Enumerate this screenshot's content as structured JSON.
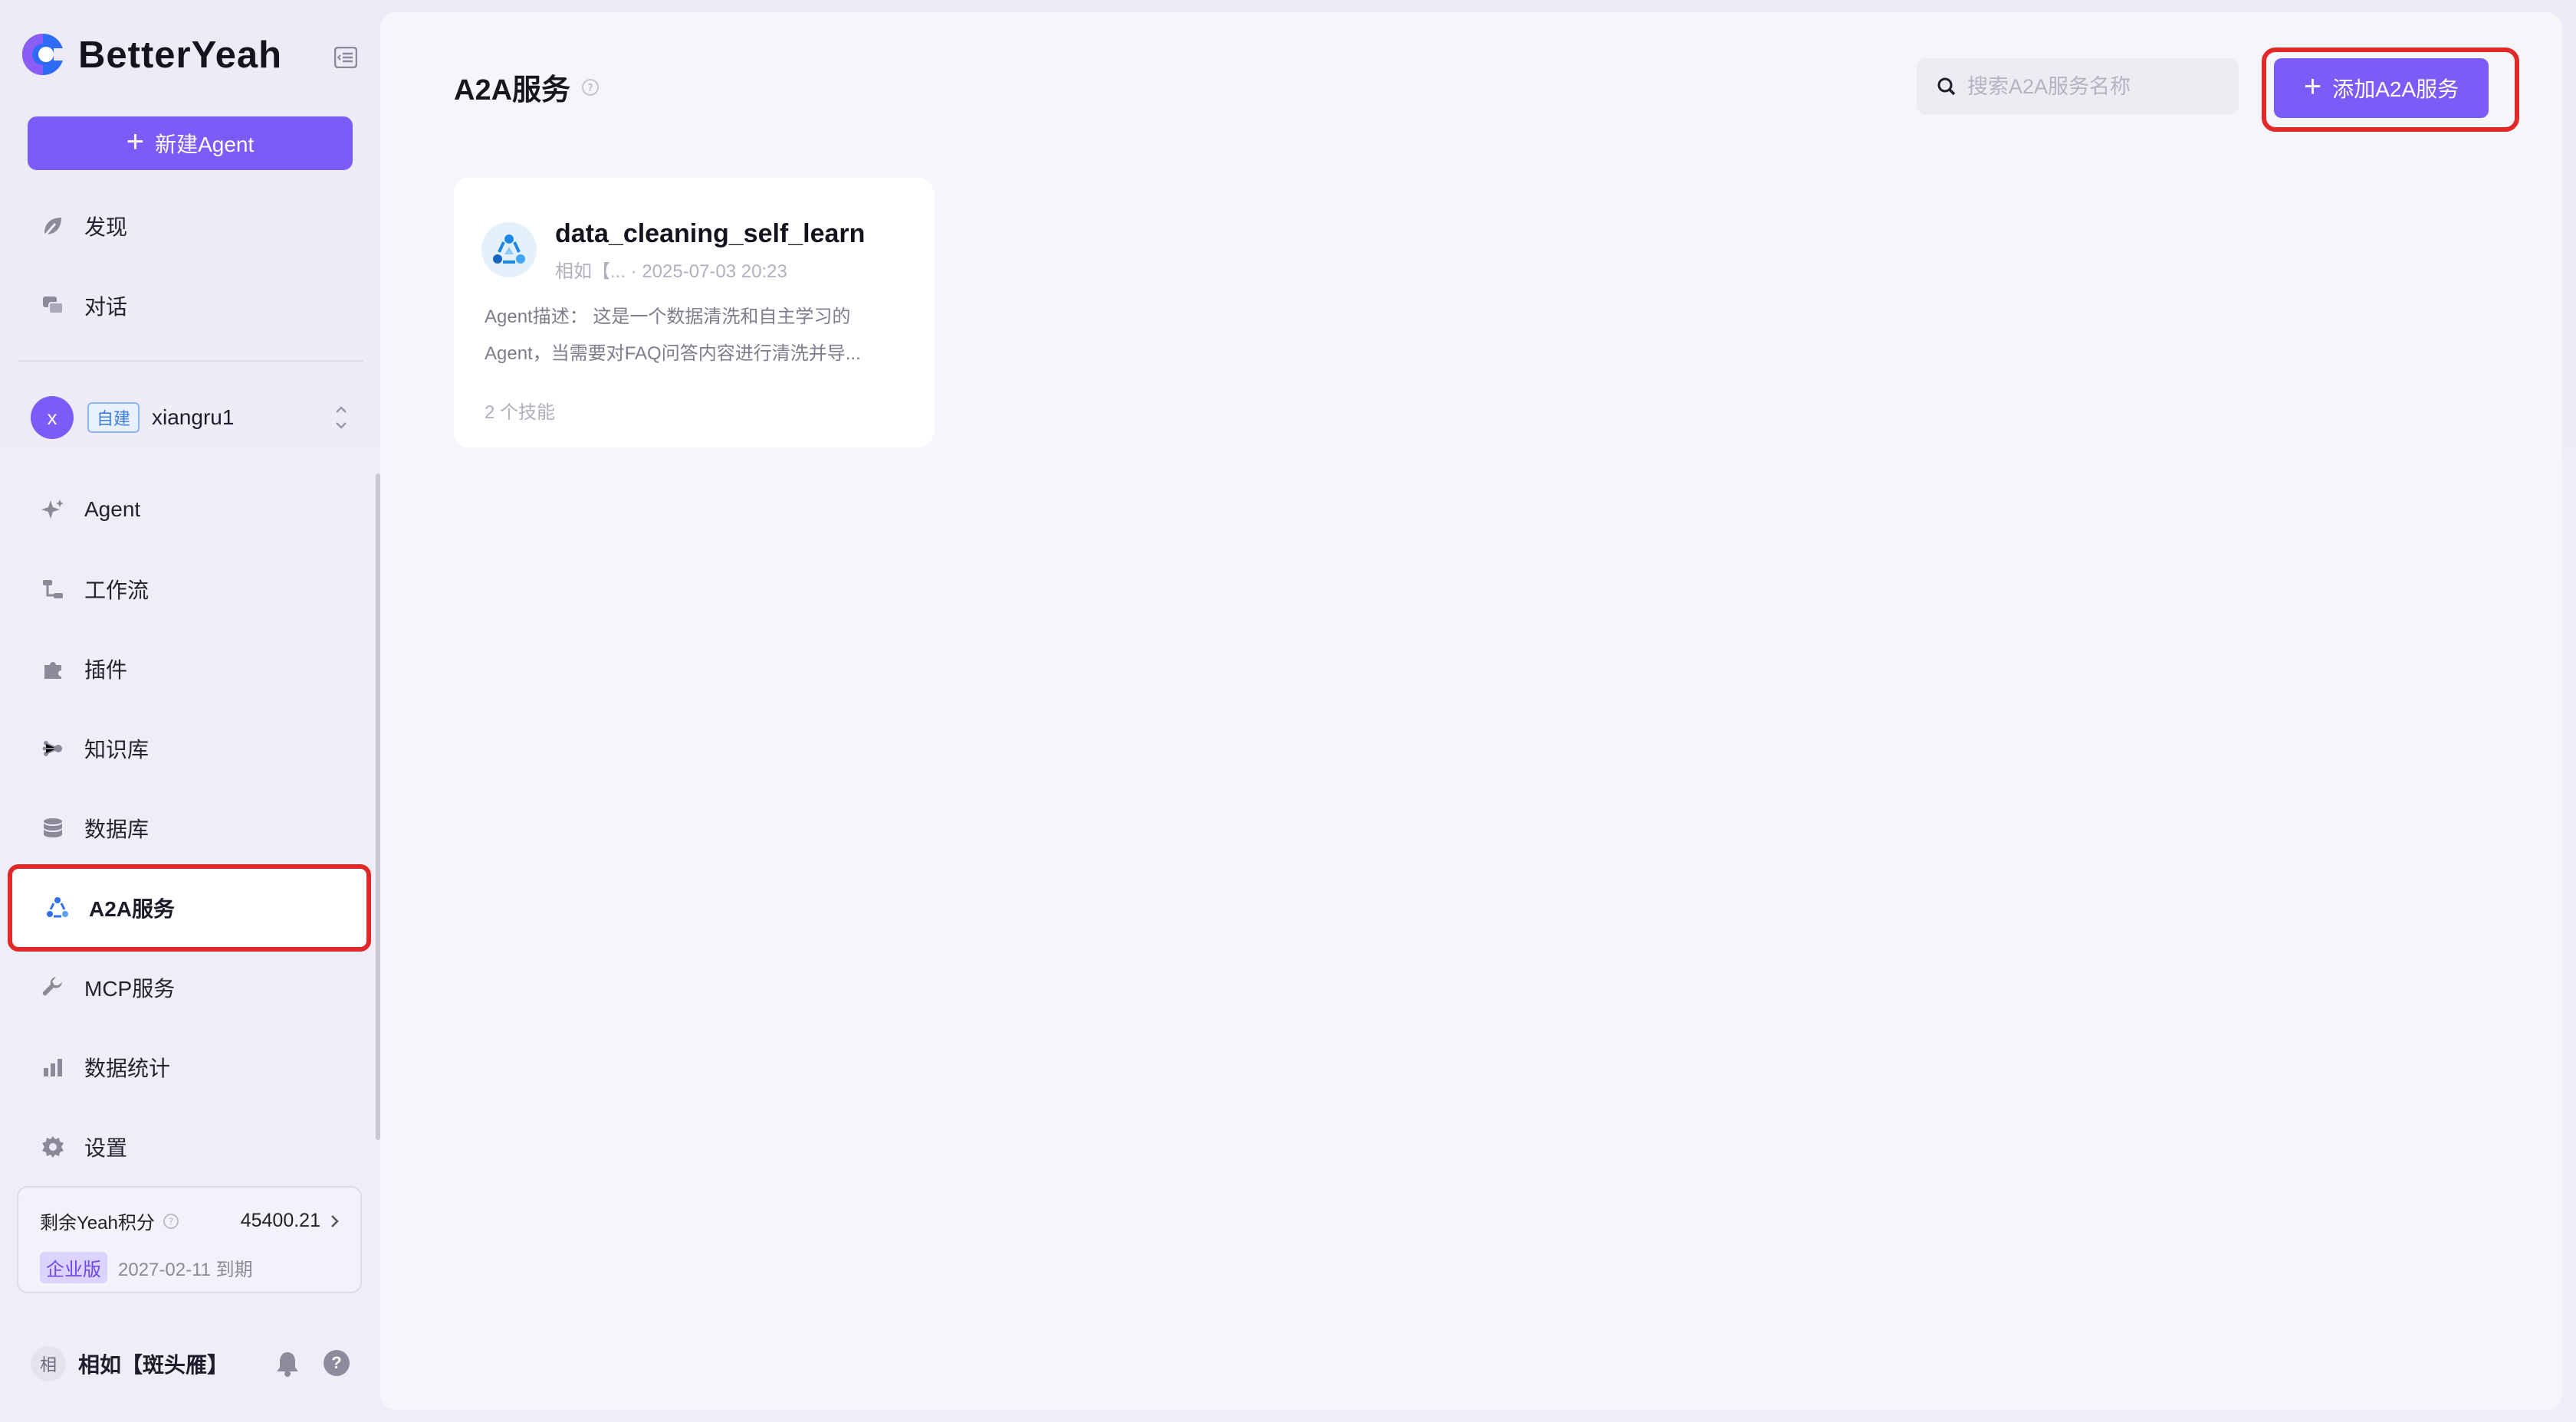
{
  "brand": {
    "name": "BetterYeah"
  },
  "sidebar": {
    "new_agent_label": "新建Agent",
    "top_items": [
      {
        "label": "发现",
        "icon": "discover-icon"
      },
      {
        "label": "对话",
        "icon": "chat-icon"
      }
    ],
    "workspace": {
      "avatar": "x",
      "tag": "自建",
      "name": "xiangru1"
    },
    "items": [
      {
        "label": "Agent",
        "icon": "sparkle-icon"
      },
      {
        "label": "工作流",
        "icon": "workflow-icon"
      },
      {
        "label": "插件",
        "icon": "puzzle-icon"
      },
      {
        "label": "知识库",
        "icon": "knowledge-icon"
      },
      {
        "label": "数据库",
        "icon": "database-icon"
      },
      {
        "label": "A2A服务",
        "icon": "a2a-icon",
        "active": true
      },
      {
        "label": "MCP服务",
        "icon": "wrench-icon"
      },
      {
        "label": "数据统计",
        "icon": "bar-chart-icon"
      },
      {
        "label": "设置",
        "icon": "gear-icon"
      }
    ],
    "credits": {
      "label": "剩余Yeah积分",
      "value": "45400.21",
      "tier": "企业版",
      "expiry": "2027-02-11 到期"
    },
    "user": {
      "avatar": "相",
      "name": "相如【斑头雁】"
    }
  },
  "main": {
    "title": "A2A服务",
    "search_placeholder": "搜索A2A服务名称",
    "add_label": "添加A2A服务",
    "cards": [
      {
        "name": "data_cleaning_self_learn",
        "meta": "相如【... · 2025-07-03 20:23",
        "desc_line1": "Agent描述： 这是一个数据清洗和自主学习的",
        "desc_line2": "Agent，当需要对FAQ问答内容进行清洗并导...",
        "skills": "2 个技能"
      }
    ]
  },
  "colors": {
    "accent": "#7b5cf6",
    "highlight": "#e02a2a",
    "background": "#f6f6fa"
  }
}
